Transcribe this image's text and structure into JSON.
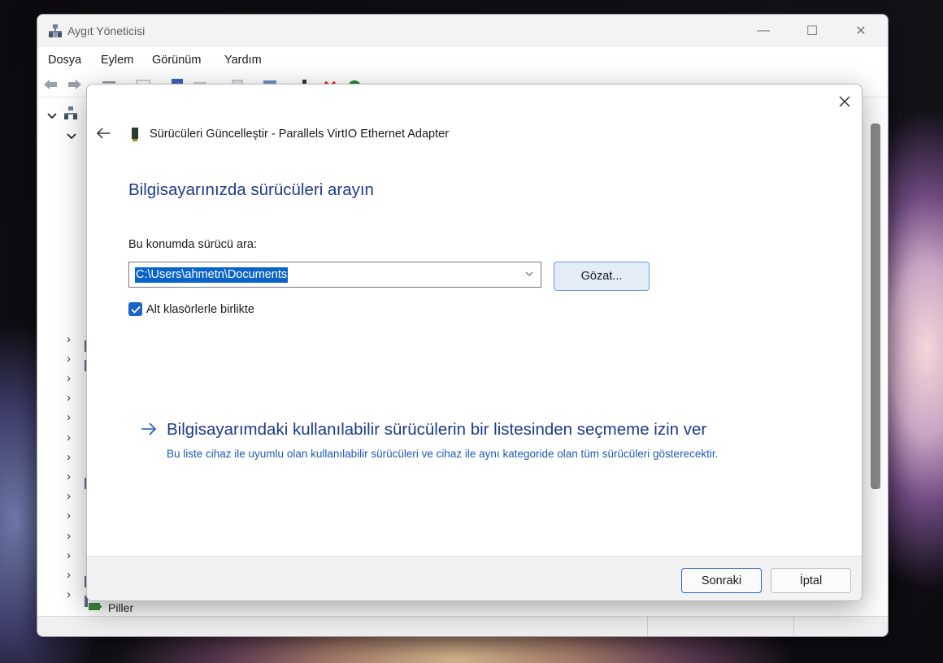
{
  "window": {
    "title": "Aygıt Yöneticisi",
    "controls": {
      "minimize": "—",
      "maximize": "☐",
      "close": "✕"
    }
  },
  "menu": [
    "Dosya",
    "Eylem",
    "Görünüm",
    "Yardım"
  ],
  "tree": {
    "partial_visible_item": "Piller"
  },
  "dialog": {
    "header_title": "Sürücüleri Güncelleştir - Parallels VirtIO Ethernet Adapter",
    "heading": "Bilgisayarınızda sürücüleri arayın",
    "search_label": "Bu konumda sürücü ara:",
    "path_value": "C:\\Users\\ahmetn\\Documents",
    "browse_label": "Gözat...",
    "include_subfolders_label": "Alt klasörlerle birlikte",
    "include_subfolders_checked": true,
    "pick_list_title": "Bilgisayarımdaki kullanılabilir sürücülerin bir listesinden seçmeme izin ver",
    "pick_list_desc": "Bu liste cihaz ile uyumlu olan kullanılabilir sürücüleri ve cihaz ile aynı kategoride olan tüm sürücüleri gösterecektir.",
    "next_label": "Sonraki",
    "cancel_label": "İptal"
  },
  "colors": {
    "accent": "#1a64c8",
    "heading_blue": "#1e3a8a",
    "link_blue": "#1e5ab4",
    "selection_blue": "#0a64c8"
  },
  "icons": [
    "device-manager-icon",
    "back-arrow-icon",
    "forward-arrow-icon",
    "network-adapter-icon",
    "checkmark-icon",
    "right-arrow-icon",
    "close-icon",
    "chevron-down-icon",
    "battery-icon"
  ]
}
